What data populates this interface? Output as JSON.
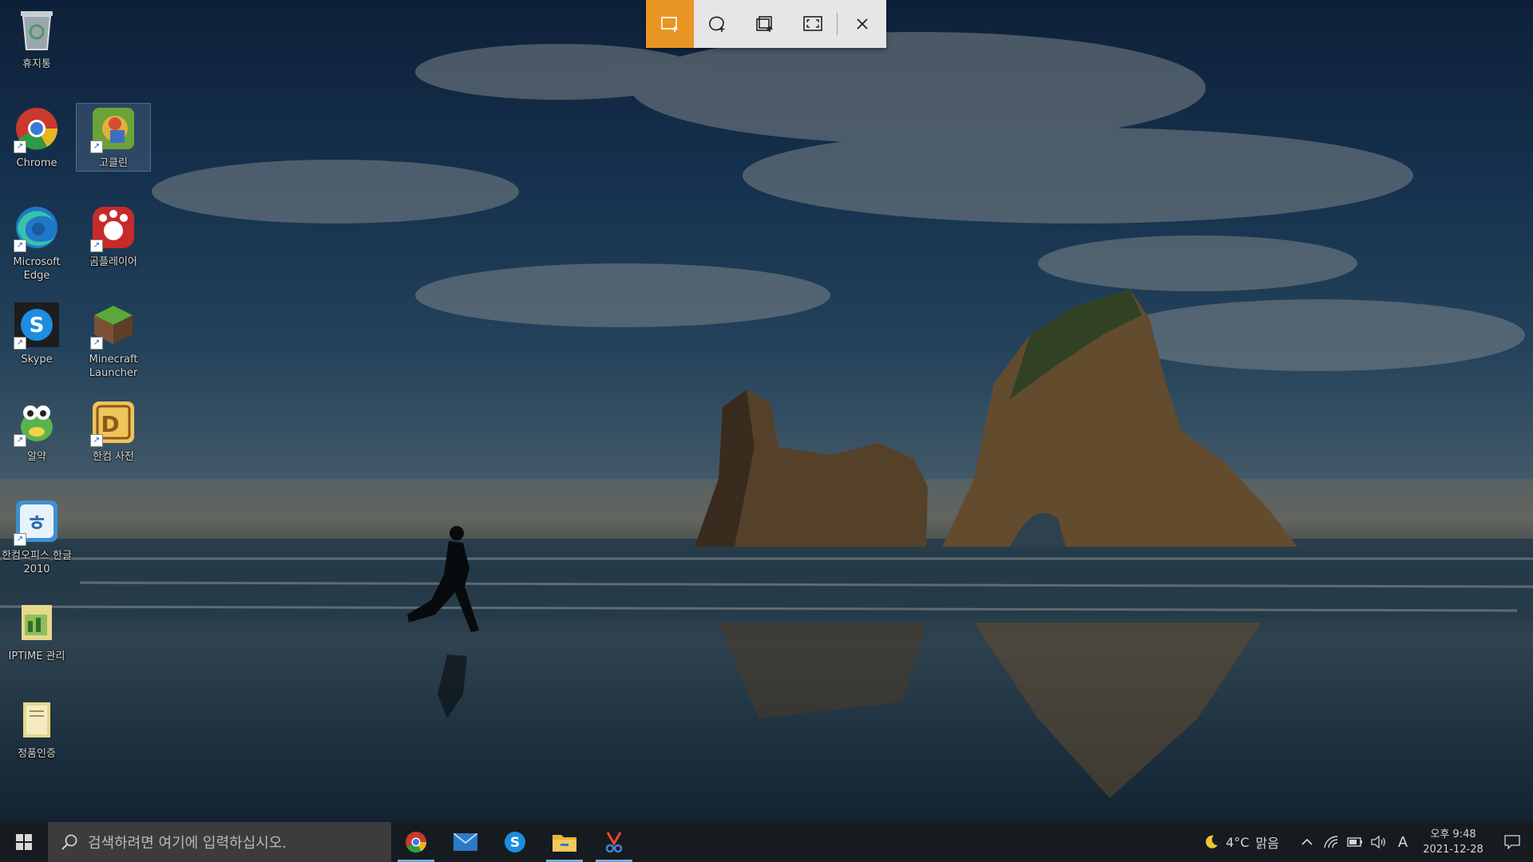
{
  "desktop": {
    "icons": [
      {
        "label": "휴지통"
      },
      {
        "label": "Chrome"
      },
      {
        "label": "고클린"
      },
      {
        "label": "Microsoft Edge"
      },
      {
        "label": "곰플레이어"
      },
      {
        "label": "Skype"
      },
      {
        "label": "Minecraft Launcher"
      },
      {
        "label": "알약"
      },
      {
        "label": "한컴 사전"
      },
      {
        "label": "한컴오피스 한글 2010"
      },
      {
        "label": "IPTIME 관리"
      },
      {
        "label": "정품인증"
      }
    ]
  },
  "snip_toolbar": {
    "buttons": [
      {
        "icon": "rectangle-snip-icon",
        "active": true
      },
      {
        "icon": "freeform-snip-icon",
        "active": false
      },
      {
        "icon": "window-snip-icon",
        "active": false
      },
      {
        "icon": "fullscreen-snip-icon",
        "active": false
      },
      {
        "icon": "close-icon",
        "active": false
      }
    ],
    "accent": "#e89524"
  },
  "taskbar": {
    "search_placeholder": "검색하려면 여기에 입력하십시오.",
    "apps": [
      "chrome",
      "mail",
      "skype",
      "file-explorer",
      "snip-and-sketch"
    ],
    "weather": {
      "temp": "4°C",
      "condition": "맑음"
    },
    "ime": "A",
    "clock": {
      "time": "오후 9:48",
      "date": "2021-12-28"
    }
  }
}
